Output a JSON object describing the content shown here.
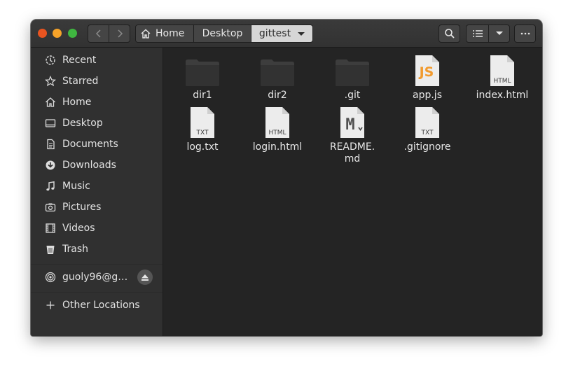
{
  "window": {
    "nav": {
      "back_icon": "chevron-left-icon",
      "forward_icon": "chevron-right-icon"
    },
    "breadcrumbs": [
      "Home",
      "Desktop",
      "gittest"
    ],
    "toolbar": {
      "search_icon": "search-icon",
      "list_icon": "list-view-icon",
      "view_options_icon": "chevron-down-icon",
      "menu_icon": "ellipsis-icon"
    }
  },
  "sidebar": {
    "items": [
      {
        "label": "Recent",
        "icon": "recent-icon"
      },
      {
        "label": "Starred",
        "icon": "star-icon"
      },
      {
        "label": "Home",
        "icon": "home-icon"
      },
      {
        "label": "Desktop",
        "icon": "desktop-icon"
      },
      {
        "label": "Documents",
        "icon": "documents-icon"
      },
      {
        "label": "Downloads",
        "icon": "downloads-icon"
      },
      {
        "label": "Music",
        "icon": "music-icon"
      },
      {
        "label": "Pictures",
        "icon": "pictures-icon"
      },
      {
        "label": "Videos",
        "icon": "videos-icon"
      },
      {
        "label": "Trash",
        "icon": "trash-icon"
      }
    ],
    "network": {
      "label": "guoly96@g…",
      "icon": "network-share-icon",
      "eject_icon": "eject-icon"
    },
    "other_locations": {
      "label": "Other Locations",
      "icon": "plus-icon"
    }
  },
  "files": [
    {
      "name": "dir1",
      "type": "folder"
    },
    {
      "name": "dir2",
      "type": "folder"
    },
    {
      "name": ".git",
      "type": "folder"
    },
    {
      "name": "app.js",
      "type": "js",
      "badge": "JS"
    },
    {
      "name": "index.html",
      "type": "doc",
      "badge": "HTML"
    },
    {
      "name": "log.txt",
      "type": "doc",
      "badge": "TXT"
    },
    {
      "name": "login.html",
      "type": "doc",
      "badge": "HTML"
    },
    {
      "name": "README.\nmd",
      "type": "md",
      "badge": "M"
    },
    {
      "name": ".gitignore",
      "type": "doc",
      "badge": "TXT"
    }
  ],
  "colors": {
    "accent": "#e95420",
    "minimize": "#f6a329",
    "maximize": "#3fb640",
    "js_orange": "#f19a2e"
  }
}
